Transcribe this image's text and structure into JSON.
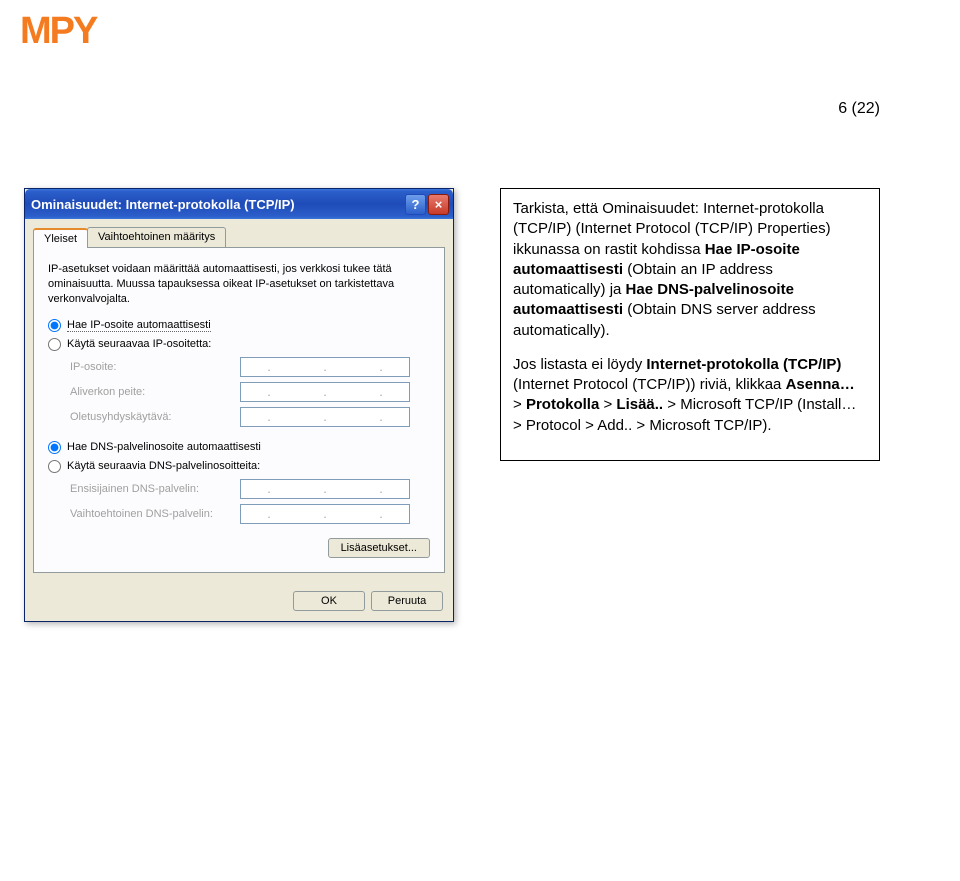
{
  "logo_text": "MPY",
  "page_number": "6 (22)",
  "dialog": {
    "title": "Ominaisuudet: Internet-protokolla (TCP/IP)",
    "tabs": {
      "general": "Yleiset",
      "alt": "Vaihtoehtoinen määritys"
    },
    "intro": "IP-asetukset voidaan määrittää automaattisesti, jos verkkosi tukee tätä ominaisuutta. Muussa tapauksessa oikeat IP-asetukset on tarkistettava verkonvalvojalta.",
    "radio_ip_auto": "Hae IP-osoite automaattisesti",
    "radio_ip_manual": "Käytä seuraavaa IP-osoitetta:",
    "field_ip": "IP-osoite:",
    "field_mask": "Aliverkon peite:",
    "field_gw": "Oletusyhdyskäytävä:",
    "radio_dns_auto": "Hae DNS-palvelinosoite automaattisesti",
    "radio_dns_manual": "Käytä seuraavia DNS-palvelinosoitteita:",
    "field_dns1": "Ensisijainen DNS-palvelin:",
    "field_dns2": "Vaihtoehtoinen DNS-palvelin:",
    "advanced": "Lisäasetukset...",
    "ok": "OK",
    "cancel": "Peruuta"
  },
  "instructions": {
    "p1a": "Tarkista, että Ominaisuudet: Internet-protokolla (TCP/IP) (Internet Protocol (TCP/IP) Properties) ikkunassa on rastit kohdissa ",
    "p1b": "Hae IP-osoite automaattisesti",
    "p1c": " (Obtain an IP address automatically) ja ",
    "p1d": "Hae DNS-palvelinosoite automaattisesti",
    "p1e": " (Obtain DNS server address automatically).",
    "p2a": "Jos listasta ei löydy ",
    "p2b": "Internet-protokolla (TCP/IP)",
    "p2c": " (Internet Protocol (TCP/IP)) riviä, klikkaa ",
    "p2d": "Asenna…",
    "p2e": " > ",
    "p2f": "Protokolla",
    "p2g": " > ",
    "p2h": "Lisää..",
    "p2i": " > Microsoft TCP/IP (Install… > Protocol > Add.. > Microsoft TCP/IP)."
  }
}
